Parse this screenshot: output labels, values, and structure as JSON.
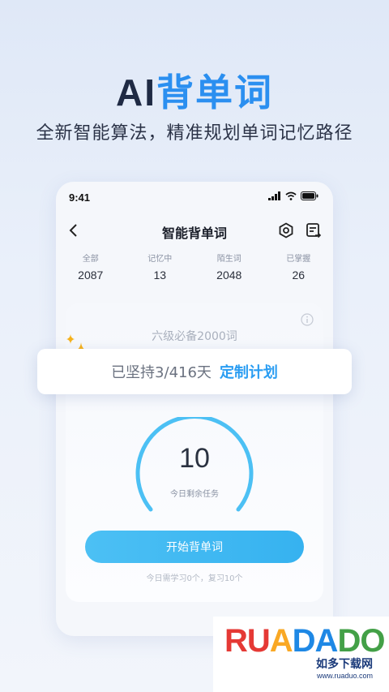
{
  "hero": {
    "title_ai": "AI",
    "title_cn": "背单词",
    "subtitle": "全新智能算法，精准规划单词记忆路径"
  },
  "status_bar": {
    "time": "9:41"
  },
  "nav": {
    "title": "智能背单词"
  },
  "stats": [
    {
      "label": "全部",
      "value": "2087"
    },
    {
      "label": "记忆中",
      "value": "13"
    },
    {
      "label": "陌生词",
      "value": "2048"
    },
    {
      "label": "已掌握",
      "value": "26"
    }
  ],
  "card": {
    "title": "六级必备2000词",
    "task_count": "10",
    "task_label": "今日剩余任务",
    "progress_fraction": 0.0,
    "start_label": "开始背单词",
    "hint": "今日需学习0个，复习10个"
  },
  "banner": {
    "streak": "已坚持3/416天",
    "plan_link": "定制计划"
  },
  "watermark": {
    "brand": [
      "RU",
      "A",
      "DA",
      "DO"
    ],
    "sub": "如多下载网",
    "url": "www.ruaduo.com"
  },
  "colors": {
    "accent": "#2b8ff0",
    "button": "#3eb8f2",
    "dial": "#4cc0f4"
  },
  "icons": [
    "back-arrow-icon",
    "settings-hex-icon",
    "edit-list-icon",
    "info-icon",
    "sparkle-icon",
    "signal-icon",
    "wifi-icon",
    "battery-icon"
  ]
}
